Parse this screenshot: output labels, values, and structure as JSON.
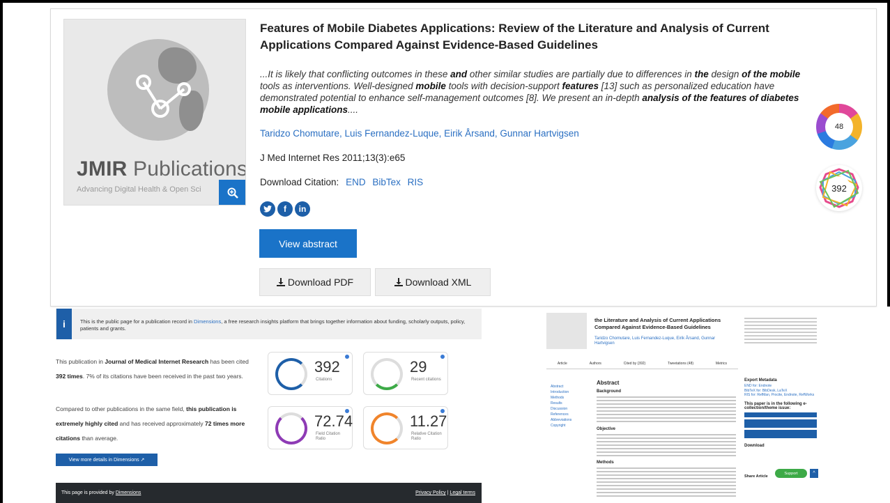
{
  "top_card": {
    "logo_brand": "JMIR",
    "logo_word": "Publications",
    "logo_tagline": "Advancing Digital Health & Open Sci",
    "title": "Features of Mobile Diabetes Applications: Review of the Literature and Analysis of Current Applications Compared Against Evidence-Based Guidelines",
    "snippet_parts": [
      "...It is likely that conflicting outcomes in these ",
      "and",
      " other similar studies are partially due to differences in ",
      "the",
      " design ",
      "of",
      " ",
      "the mobile",
      " tools as interventions. Well-designed ",
      "mobile",
      " tools with decision-support ",
      "features",
      " [13] such as personalized education have demonstrated potential to enhance self-management outcomes [8]. We present an in-depth ",
      "analysis of",
      " ",
      "the features of diabetes mobile applications",
      "...."
    ],
    "authors": "Taridzo Chomutare, Luis Fernandez-Luque, Eirik Årsand, Gunnar Hartvigsen",
    "journal": "J Med Internet Res 2011;13(3):e65",
    "download_citation_label": "Download Citation:",
    "citation_formats": [
      "END",
      "BibTex",
      "RIS"
    ],
    "view_abstract": "View abstract",
    "download_pdf": "Download PDF",
    "download_xml": "Download XML",
    "altmetric_score": "48",
    "dimensions_citations": "392"
  },
  "dimensions_panel": {
    "info_text_a": "This is the public page for a publication record in ",
    "info_link": "Dimensions",
    "info_text_b": ", a free research insights platform that brings together information about funding, scholarly outputs, policy, patients and grants.",
    "p1_a": "This publication in ",
    "p1_journal": "Journal of Medical Internet Research",
    "p1_b": " has been cited ",
    "p1_times": "392 times",
    "p1_c": ". 7% of its citations have been received in the past two years.",
    "p2_a": "Compared to other publications in the same field, ",
    "p2_bold": "this publication is extremely highly cited",
    "p2_b": " and has received approximately ",
    "p2_bold2": "72 times more citations",
    "p2_c": " than average.",
    "button": "View more details in Dimensions",
    "metrics": [
      {
        "value": "392",
        "label": "Citations"
      },
      {
        "value": "29",
        "label": "Recent citations"
      },
      {
        "value": "72.74",
        "label": "Field Citation Ratio"
      },
      {
        "value": "11.27",
        "label": "Relative Citation Ratio"
      }
    ],
    "footer_left_a": "This page is provided by ",
    "footer_left_link": "Dimensions",
    "footer_privacy": "Privacy Policy",
    "footer_sep": "|",
    "footer_legal": "Legal terms"
  },
  "article_panel": {
    "title": "the Literature and Analysis of Current Applications Compared Against Evidence-Based Guidelines",
    "authors": "Taridzo Chomutare, Luis Fernandez-Luque, Eirik Årsand, Gunnar Hartvigsen",
    "tabs": [
      "Article",
      "Authors",
      "Cited by (392)",
      "Tweetations (48)",
      "Metrics"
    ],
    "nav": [
      "Abstract",
      "Introduction",
      "Methods",
      "Results",
      "Discussion",
      "References",
      "Abbreviations",
      "Copyright"
    ],
    "abstract_heading": "Abstract",
    "sections": [
      "Background",
      "Objective",
      "Methods"
    ],
    "side_export": "Export Metadata",
    "side_export_items": [
      "END for: Endnote",
      "BibTeX for: BibDesk, LaTeX",
      "RIS for: RefMan, Procite, Endnote, RefWorks"
    ],
    "side_collections": "This paper is in the following e-collection/theme issue:",
    "side_download": "Download",
    "support_button": "Support",
    "share_label": "Share Article"
  }
}
